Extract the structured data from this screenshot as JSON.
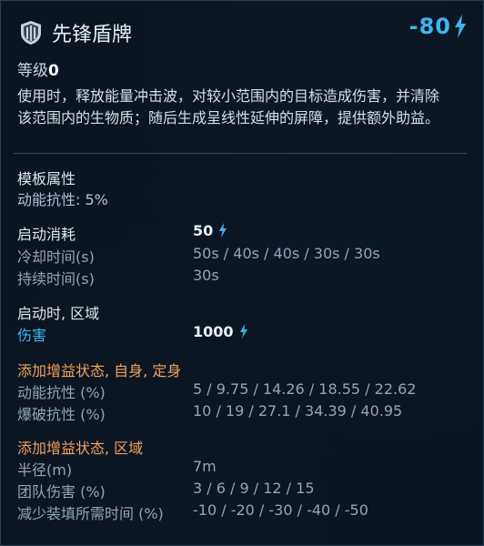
{
  "ability": {
    "title": "先锋盾牌",
    "cost": "-80",
    "level_label": "等级",
    "level_value": "0",
    "description_line1": "使用时，释放能量冲击波，对较小范围内的目标造成伤害，并清除",
    "description_line2": "该范围内的生物质；随后生成呈线性延伸的屏障，提供额外助益。"
  },
  "mod_attributes": {
    "title": "模板属性",
    "stat": "动能抗性: 5%"
  },
  "activation": {
    "cost_label": "启动消耗",
    "cost_value": "50",
    "cooldown_label": "冷却时间(s)",
    "cooldown_value": "50s / 40s / 40s / 30s / 30s",
    "duration_label": "持续时间(s)",
    "duration_value": "30s"
  },
  "on_activate_area": {
    "title": "启动时, 区域",
    "damage_label": "伤害",
    "damage_value": "1000"
  },
  "buff_self": {
    "title": "添加增益状态, 自身, 定身",
    "rows": [
      {
        "label": "动能抗性 (%)",
        "value": "5 / 9.75 / 14.26 / 18.55 / 22.62"
      },
      {
        "label": "爆破抗性 (%)",
        "value": "10 / 19 / 27.1 / 34.39 / 40.95"
      }
    ]
  },
  "buff_area": {
    "title": "添加增益状态, 区域",
    "rows": [
      {
        "label": "半径(m)",
        "value": "7m"
      },
      {
        "label": "团队伤害 (%)",
        "value": "3 / 6 / 9 / 12 / 15"
      },
      {
        "label": "减少装填所需时间 (%)",
        "value": "-10 / -20 / -30 / -40 / -50"
      }
    ]
  },
  "colors": {
    "accent_cyan": "#3fb4f0",
    "section_orange": "#f0a05a",
    "background": "#0c1622"
  },
  "icons": [
    "shield-icon",
    "energy-bolt-icon"
  ]
}
